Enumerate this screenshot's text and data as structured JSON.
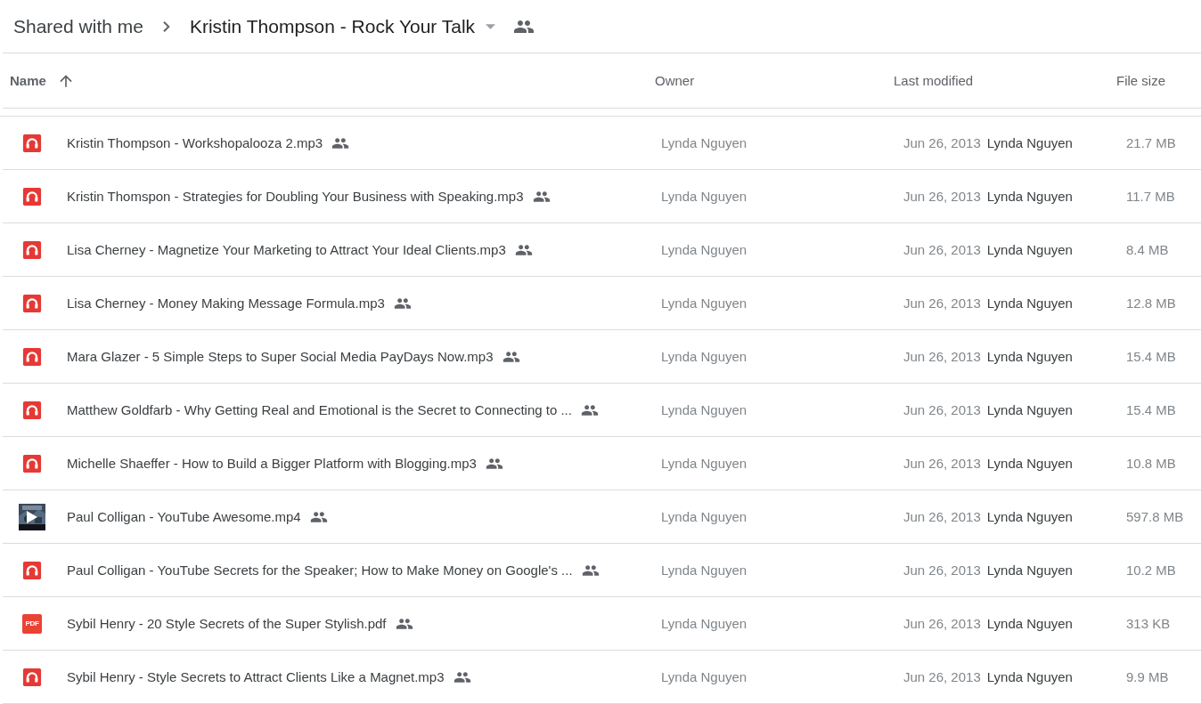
{
  "breadcrumb": {
    "parent": "Shared with me",
    "current": "Kristin Thompson - Rock Your Talk"
  },
  "table": {
    "columns": [
      {
        "label": "Name",
        "sorted": true
      },
      {
        "label": "Owner",
        "sorted": false
      },
      {
        "label": "Last modified",
        "sorted": false
      },
      {
        "label": "File size",
        "sorted": false
      }
    ],
    "rows": [
      {
        "kind": "audio",
        "name": "Kristin Thompson - Workshopalooza 2.mp3",
        "shared": true,
        "owner": "Lynda Nguyen",
        "date": "Jun 26, 2013",
        "modified_by": "Lynda Nguyen",
        "size": "21.7 MB"
      },
      {
        "kind": "audio",
        "name": "Kristin Thomspon - Strategies for Doubling Your Business with Speaking.mp3",
        "shared": true,
        "owner": "Lynda Nguyen",
        "date": "Jun 26, 2013",
        "modified_by": "Lynda Nguyen",
        "size": "11.7 MB"
      },
      {
        "kind": "audio",
        "name": "Lisa Cherney - Magnetize Your Marketing to Attract Your Ideal Clients.mp3",
        "shared": true,
        "owner": "Lynda Nguyen",
        "date": "Jun 26, 2013",
        "modified_by": "Lynda Nguyen",
        "size": "8.4 MB"
      },
      {
        "kind": "audio",
        "name": "Lisa Cherney - Money Making Message Formula.mp3",
        "shared": true,
        "owner": "Lynda Nguyen",
        "date": "Jun 26, 2013",
        "modified_by": "Lynda Nguyen",
        "size": "12.8 MB"
      },
      {
        "kind": "audio",
        "name": "Mara Glazer - 5 Simple Steps to Super Social Media PayDays Now.mp3",
        "shared": true,
        "owner": "Lynda Nguyen",
        "date": "Jun 26, 2013",
        "modified_by": "Lynda Nguyen",
        "size": "15.4 MB"
      },
      {
        "kind": "audio",
        "name": "Matthew Goldfarb - Why Getting Real and Emotional is the Secret to Connecting to ...",
        "shared": true,
        "owner": "Lynda Nguyen",
        "date": "Jun 26, 2013",
        "modified_by": "Lynda Nguyen",
        "size": "15.4 MB"
      },
      {
        "kind": "audio",
        "name": "Michelle Shaeffer - How to Build a Bigger Platform with Blogging.mp3",
        "shared": true,
        "owner": "Lynda Nguyen",
        "date": "Jun 26, 2013",
        "modified_by": "Lynda Nguyen",
        "size": "10.8 MB"
      },
      {
        "kind": "video",
        "name": "Paul Colligan - YouTube Awesome.mp4",
        "shared": true,
        "owner": "Lynda Nguyen",
        "date": "Jun 26, 2013",
        "modified_by": "Lynda Nguyen",
        "size": "597.8 MB"
      },
      {
        "kind": "audio",
        "name": "Paul Colligan - YouTube Secrets for the Speaker; How to Make Money on Google's ...",
        "shared": true,
        "owner": "Lynda Nguyen",
        "date": "Jun 26, 2013",
        "modified_by": "Lynda Nguyen",
        "size": "10.2 MB"
      },
      {
        "kind": "pdf",
        "type_label": "PDF",
        "name": "Sybil Henry - 20 Style Secrets of the Super Stylish.pdf",
        "shared": true,
        "owner": "Lynda Nguyen",
        "date": "Jun 26, 2013",
        "modified_by": "Lynda Nguyen",
        "size": "313 KB"
      },
      {
        "kind": "audio",
        "name": "Sybil Henry - Style Secrets to Attract Clients Like a Magnet.mp3",
        "shared": true,
        "owner": "Lynda Nguyen",
        "date": "Jun 26, 2013",
        "modified_by": "Lynda Nguyen",
        "size": "9.9 MB"
      }
    ]
  }
}
